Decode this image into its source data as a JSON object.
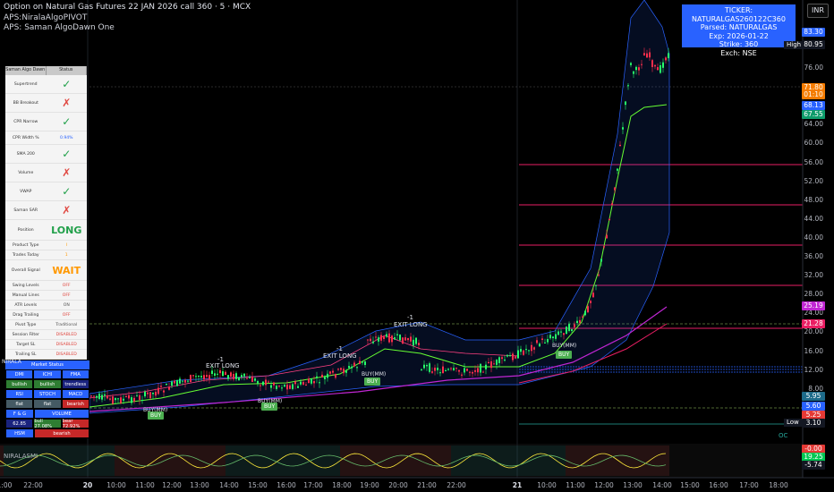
{
  "header": {
    "title": "Option on Natural Gas Futures 22 JAN 2026 call 360 · 5 · MCX",
    "indicator1": "APS:NiralaAlgoPIVOT",
    "indicator2": "APS: Saman AlgoDawn One",
    "currency": "INR"
  },
  "ticker_box": {
    "line1": "TICKER: NATURALGAS260122C360",
    "line2": "Parsed: NATURALGAS",
    "line3": "Exp: 2026-01-22",
    "line4": "Strike: 360",
    "line5": "Exch: NSE"
  },
  "price_axis": [
    "76.00",
    "72.00",
    "68.00",
    "64.00",
    "60.00",
    "56.00",
    "52.00",
    "48.00",
    "44.00",
    "40.00",
    "36.00",
    "32.00",
    "28.00",
    "24.00",
    "20.00",
    "16.00",
    "12.00",
    "8.00",
    "4.00"
  ],
  "price_pills": [
    {
      "text": "83.30",
      "color": "#2962ff"
    },
    {
      "text": "80.95",
      "color": "#131722"
    },
    {
      "text": "71.80",
      "color": "#f57c00"
    },
    {
      "text": "01:10",
      "color": "#f57c00"
    },
    {
      "text": "68.13",
      "color": "#2962ff"
    },
    {
      "text": "67.55",
      "color": "#0d9c6b"
    },
    {
      "text": "25.19",
      "color": "#c026d3"
    },
    {
      "text": "21.28",
      "color": "#e91e63"
    },
    {
      "text": "5.95",
      "color": "#1e6b8a"
    },
    {
      "text": "5.60",
      "color": "#2962ff"
    },
    {
      "text": "5.25",
      "color": "#e53935"
    },
    {
      "text": "3.10",
      "color": "#131722"
    },
    {
      "text": "-0.00",
      "color": "#e53935"
    },
    {
      "text": "19.25",
      "color": "#00c853"
    },
    {
      "text": "-5.74",
      "color": "#131722"
    }
  ],
  "hi_lo": {
    "high": "High",
    "low": "Low"
  },
  "time_axis": [
    "1:00",
    "22:00",
    "20",
    "10:00",
    "11:00",
    "12:00",
    "13:00",
    "14:00",
    "15:00",
    "16:00",
    "17:00",
    "18:00",
    "19:00",
    "20:00",
    "21:00",
    "22:00",
    "21",
    "10:00",
    "11:00",
    "12:00",
    "13:00",
    "14:00",
    "15:00",
    "16:00",
    "17:00",
    "18:00"
  ],
  "status_panel": {
    "headers": [
      "Saman Algo Dawn",
      "Status"
    ],
    "rows": [
      {
        "label": "Supertrend",
        "value": "✓",
        "kind": "check"
      },
      {
        "label": "BB Breakout",
        "value": "✗",
        "kind": "cross"
      },
      {
        "label": "CPR Narrow",
        "value": "✓",
        "kind": "check"
      },
      {
        "label": "CPR Width %",
        "value": "0.94%",
        "kind": "text-blue"
      },
      {
        "label": "SMA 200",
        "value": "✓",
        "kind": "check"
      },
      {
        "label": "Volume",
        "value": "✗",
        "kind": "cross"
      },
      {
        "label": "VWAP",
        "value": "✓",
        "kind": "check"
      },
      {
        "label": "Saman SAR",
        "value": "✗",
        "kind": "cross"
      },
      {
        "label": "Position",
        "value": "LONG",
        "kind": "big-green"
      },
      {
        "label": "Product Type",
        "value": "I",
        "kind": "text-orange"
      },
      {
        "label": "Trades Today",
        "value": "1",
        "kind": "text-orange"
      },
      {
        "label": "Overall Signal",
        "value": "WAIT",
        "kind": "big-orange"
      },
      {
        "label": "Swing Levels",
        "value": "OFF",
        "kind": "text-red"
      },
      {
        "label": "Manual Lines",
        "value": "OFF",
        "kind": "text-red"
      },
      {
        "label": "ATR Levels",
        "value": "ON",
        "kind": "text-gray"
      },
      {
        "label": "Drag Trailing",
        "value": "OFF",
        "kind": "text-red"
      },
      {
        "label": "Pivot Type",
        "value": "Traditional",
        "kind": "text-gray"
      },
      {
        "label": "Session Filter",
        "value": "DISABLED",
        "kind": "text-red"
      },
      {
        "label": "Target SL",
        "value": "DISABLED",
        "kind": "text-red"
      },
      {
        "label": "Trailing SL",
        "value": "DISABLED",
        "kind": "text-red"
      },
      {
        "label": "SMA Filter",
        "value": "ON",
        "kind": "text-gray"
      },
      {
        "label": "VWAP Filter",
        "value": "ON",
        "kind": "text-gray"
      },
      {
        "label": "SS Filter",
        "value": "ON",
        "kind": "text-gray"
      }
    ]
  },
  "market_status": {
    "title": "Market Status",
    "rows": [
      [
        {
          "t": "DMI",
          "c": "#2962ff"
        },
        {
          "t": "ICHI",
          "c": "#2962ff"
        },
        {
          "t": "FMA",
          "c": "#2962ff"
        }
      ],
      [
        {
          "t": "bullish",
          "c": "#2e7d32"
        },
        {
          "t": "bullish",
          "c": "#2e7d32"
        },
        {
          "t": "trendless",
          "c": "#1a237e"
        }
      ],
      [
        {
          "t": "RSI",
          "c": "#2962ff"
        },
        {
          "t": "STOCH",
          "c": "#2962ff"
        },
        {
          "t": "MACD",
          "c": "#2962ff"
        }
      ],
      [
        {
          "t": "flat",
          "c": "#455a64"
        },
        {
          "t": "flat",
          "c": "#455a64"
        },
        {
          "t": "bearish",
          "c": "#c62828"
        }
      ],
      [
        {
          "t": "F & G",
          "c": "#2962ff",
          "w": 1
        },
        {
          "t": "VOLUME",
          "c": "#2962ff",
          "w": 2
        }
      ],
      [
        {
          "t": "62.85",
          "c": "#1a237e"
        },
        {
          "t": "bull 27.08%",
          "c": "#2e7d32"
        },
        {
          "t": "bear 72.92%",
          "c": "#c62828"
        }
      ],
      [
        {
          "t": "HSM",
          "c": "#2962ff",
          "w": 1
        },
        {
          "t": "bearish",
          "c": "#c62828",
          "w": 2
        }
      ]
    ]
  },
  "chart_labels": {
    "exit1": "EXIT LONG",
    "exit2": "EXIT LONG",
    "exit3": "EXIT LONG",
    "m1": "-1",
    "m2": "-1",
    "m3": "-1",
    "buymm1": "BUY(MM)",
    "buymm2": "BUY(MM)",
    "buymm3": "BUY(MM)",
    "buymm4": "BUY(MM)",
    "buy": "BUY",
    "oc": "OC",
    "nirala": "NIRALA"
  },
  "indicator_pane": {
    "name": "NIRALASMI"
  }
}
